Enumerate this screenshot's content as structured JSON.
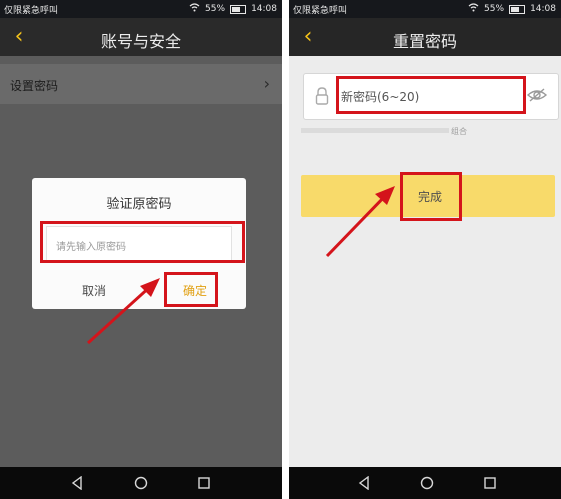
{
  "left": {
    "status": {
      "carrier": "仅限紧急呼叫",
      "battery": "55%",
      "time": "14:08"
    },
    "title": "账号与安全",
    "settings_row_label": "设置密码",
    "dialog": {
      "title": "验证原密码",
      "password_placeholder": "请先输入原密码",
      "cancel": "取消",
      "confirm": "确定"
    }
  },
  "right": {
    "status": {
      "carrier": "仅限紧急呼叫",
      "battery": "55%",
      "time": "14:08"
    },
    "title": "重置密码",
    "new_password_placeholder": "新密码(6~20)",
    "strength_hint": "组合",
    "done": "完成"
  },
  "colors": {
    "accent": "#f4c21a",
    "button_yellow": "#f8da6a",
    "highlight_red": "#d4141b"
  },
  "icons": [
    "back-arrow-icon",
    "chevron-right-icon",
    "lock-icon",
    "eye-icon",
    "wifi-icon",
    "battery-icon",
    "nav-back-icon",
    "nav-home-icon",
    "nav-recents-icon"
  ]
}
